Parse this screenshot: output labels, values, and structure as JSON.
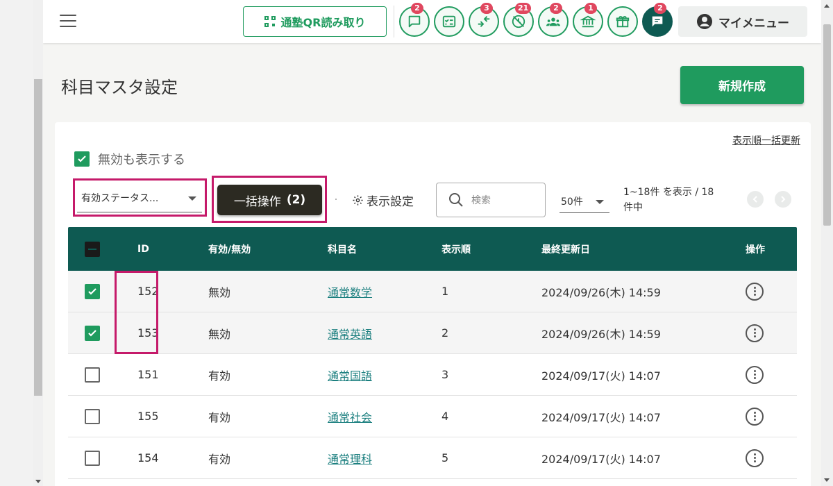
{
  "topbar": {
    "qr_button_label": "通塾QR読み取り",
    "icon_buttons": [
      {
        "name": "chat-icon",
        "badge": "2"
      },
      {
        "name": "checklist-icon",
        "badge": ""
      },
      {
        "name": "merge-arrows-icon",
        "badge": "3"
      },
      {
        "name": "no-clock-icon",
        "badge": "21"
      },
      {
        "name": "group-icon",
        "badge": "2"
      },
      {
        "name": "bank-icon",
        "badge": "1"
      },
      {
        "name": "gift-icon",
        "badge": ""
      },
      {
        "name": "message-icon",
        "badge": "2"
      }
    ],
    "my_menu_label": "マイメニュー"
  },
  "page": {
    "title": "科目マスタ設定",
    "new_button_label": "新規作成"
  },
  "controls": {
    "bulk_order_update_link": "表示順一括更新",
    "show_invalid_label": "無効も表示する",
    "show_invalid_checked": true,
    "status_filter_value": "有効ステータス...",
    "bulk_action_label": "一括操作",
    "bulk_action_count": "(2)",
    "display_settings_label": "表示設定",
    "search_placeholder": "検索",
    "per_page_value": "50件",
    "range_info": "1~18件 を表示 / 18件中"
  },
  "table": {
    "headers": {
      "id": "ID",
      "status": "有効/無効",
      "name": "科目名",
      "order": "表示順",
      "updated": "最終更新日",
      "actions": "操作"
    },
    "rows": [
      {
        "checked": true,
        "id": "152",
        "status": "無効",
        "name": "通常数学",
        "order": "1",
        "updated": "2024/09/26(木) 14:59"
      },
      {
        "checked": true,
        "id": "153",
        "status": "無効",
        "name": "通常英語",
        "order": "2",
        "updated": "2024/09/26(木) 14:59"
      },
      {
        "checked": false,
        "id": "151",
        "status": "有効",
        "name": "通常国語",
        "order": "3",
        "updated": "2024/09/17(火) 14:07"
      },
      {
        "checked": false,
        "id": "155",
        "status": "有効",
        "name": "通常社会",
        "order": "4",
        "updated": "2024/09/17(火) 14:07"
      },
      {
        "checked": false,
        "id": "154",
        "status": "有効",
        "name": "通常理科",
        "order": "5",
        "updated": "2024/09/17(火) 14:07"
      }
    ]
  },
  "colors": {
    "primary_green": "#1f9b5e",
    "header_teal": "#0e5a52",
    "highlight_magenta": "#c51a6a",
    "badge_red": "#e0475f"
  }
}
